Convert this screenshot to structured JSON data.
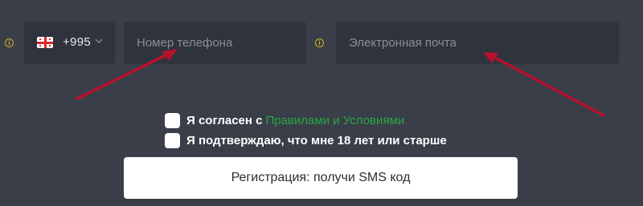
{
  "country_selector": {
    "flag": "georgia-flag",
    "code": "+995",
    "chevron": "chevron-down-icon"
  },
  "phone_field": {
    "value": "",
    "placeholder": "Номер телефона"
  },
  "email_field": {
    "value": "",
    "placeholder": "Электронная почта"
  },
  "info_icon": {
    "glyph": "i",
    "color": "#d4b21e"
  },
  "consents": {
    "terms_prefix": "Я согласен с",
    "terms_link": "Правилами и Условиями",
    "age_confirm": "Я подтверждаю, что мне 18 лет или старше"
  },
  "submit_button": {
    "label": "Регистрация: получи SMS код"
  },
  "colors": {
    "background": "#3a3e49",
    "field": "#2f333d",
    "link": "#27a844",
    "annotation_arrow": "#b8112c"
  }
}
